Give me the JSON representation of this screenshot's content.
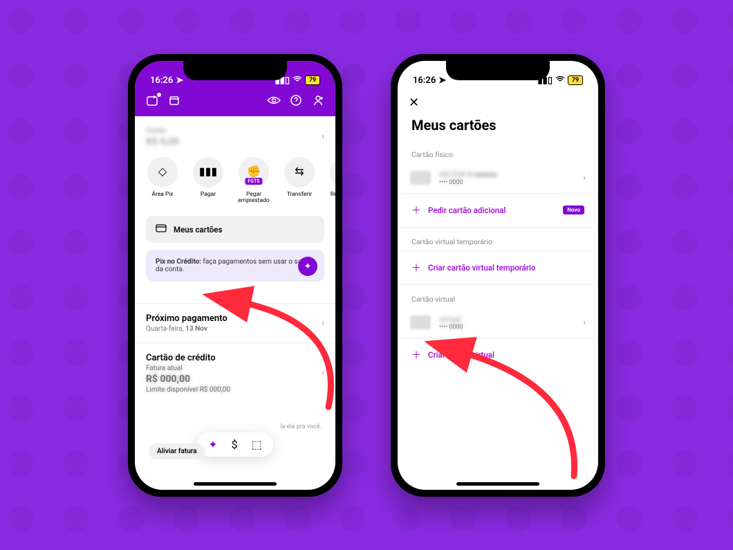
{
  "status": {
    "time": "16:26",
    "battery": "79"
  },
  "phoneA": {
    "account_label": "Conta",
    "account_balance": "R$ 0,00",
    "chips": [
      {
        "label": "Área Pix"
      },
      {
        "label": "Pagar"
      },
      {
        "label": "Pegar emprestado",
        "badge": "FGTS"
      },
      {
        "label": "Transferir"
      },
      {
        "label": "Recarga de celular"
      }
    ],
    "my_cards": "Meus cartões",
    "promo_bold": "Pix no Crédito:",
    "promo_rest": " faça pagamentos sem usar o saldo da conta.",
    "next_payment_title": "Próximo pagamento",
    "next_payment_sub": "Quarta-feira, 13 Nov",
    "credit_title": "Cartão de crédito",
    "credit_l1": "Fatura atual",
    "credit_l2": "R$ 000,00",
    "credit_l3": "Limite disponível R$ 000,00",
    "footer_caption": "la ela pra você.",
    "relieve": "Aliviar fatura"
  },
  "phoneB": {
    "title": "Meus cartões",
    "sec1": "Cartão físico",
    "card1_name": "VICTOR B ■■■■■",
    "card1_sub": "•••• 0000",
    "action1": "Pedir cartão adicional",
    "badge_new": "Novo",
    "sec2": "Cartão virtual temporário",
    "action2": "Criar cartão virtual temporário",
    "sec3": "Cartão virtual",
    "card3_name": "virtual",
    "card3_sub": "•••• 0000",
    "action3": "Criar cartão virtual"
  }
}
